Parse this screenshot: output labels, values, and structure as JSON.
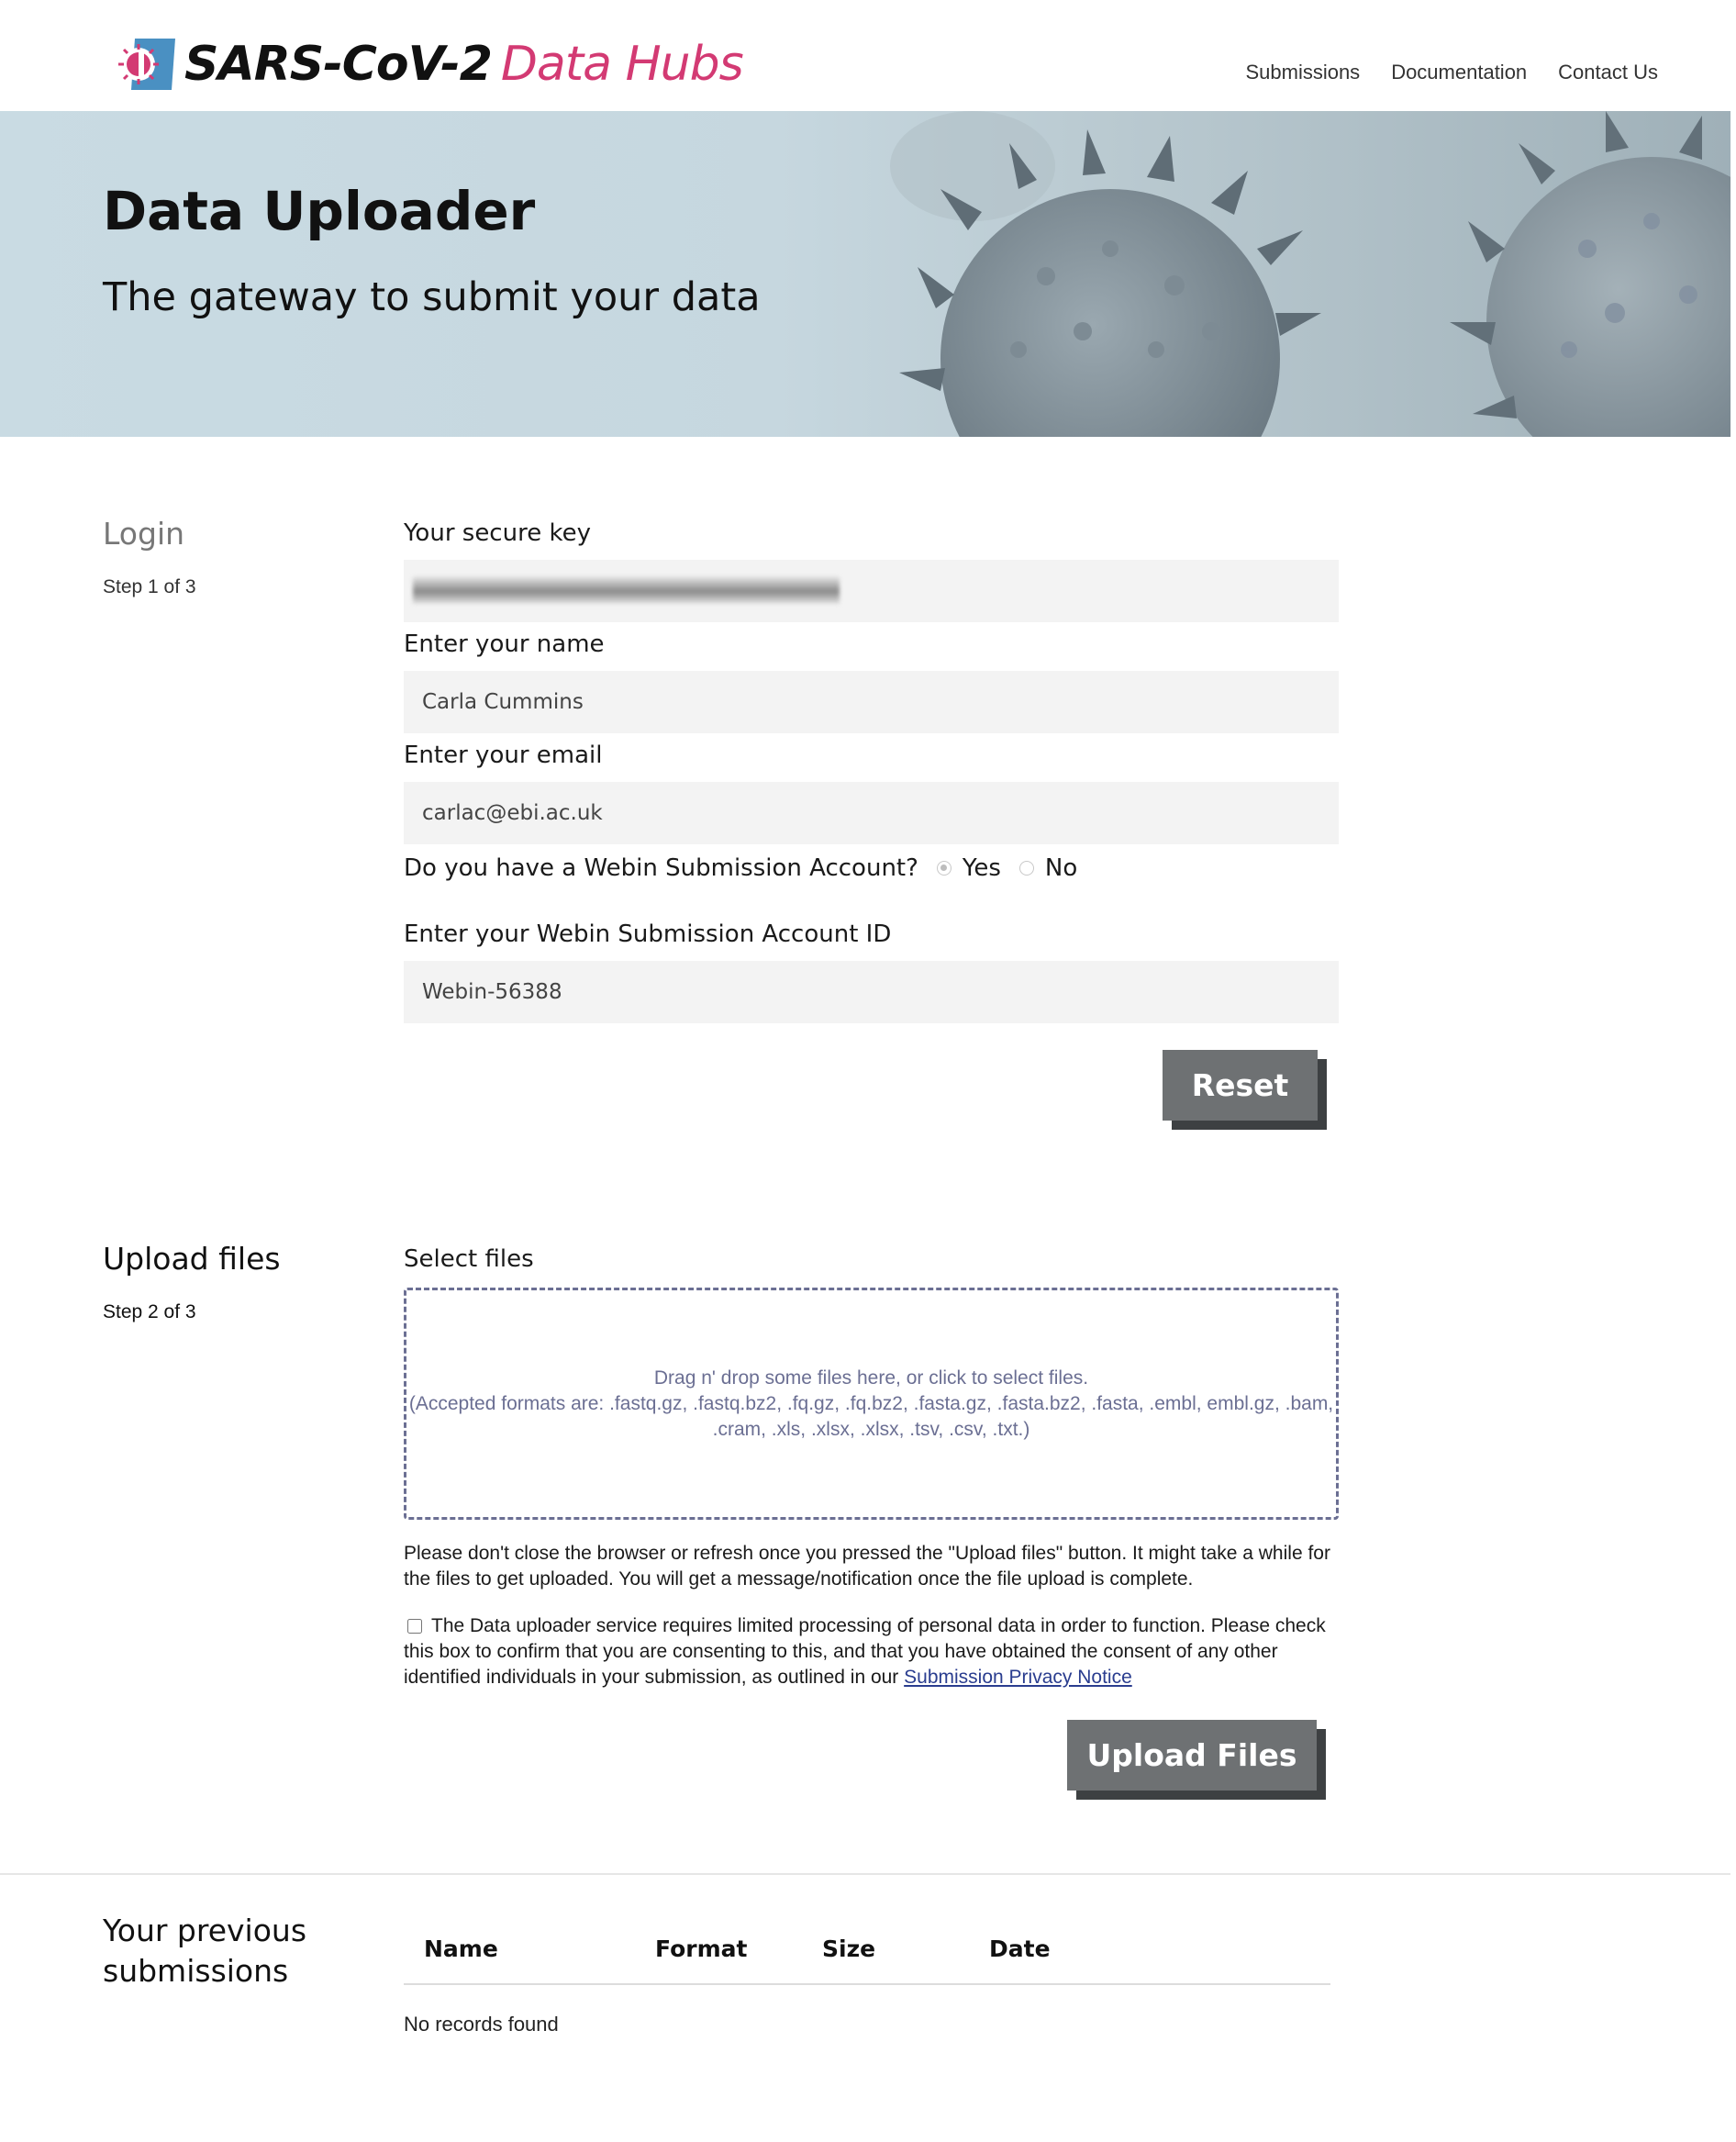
{
  "header": {
    "logo_strong": "SARS-CoV-2",
    "logo_accent": "Data Hubs",
    "nav": [
      "Submissions",
      "Documentation",
      "Contact Us"
    ]
  },
  "hero": {
    "title": "Data Uploader",
    "subtitle": "The gateway to submit your data"
  },
  "login": {
    "title": "Login",
    "step": "Step 1 of 3",
    "secure_key_label": "Your secure key",
    "name_label": "Enter your name",
    "name_value": "Carla Cummins",
    "email_label": "Enter your email",
    "email_value": "carlac@ebi.ac.uk",
    "webin_question": "Do you have a Webin Submission Account?",
    "yes_label": "Yes",
    "no_label": "No",
    "selected": "Yes",
    "webin_id_label": "Enter your Webin Submission Account ID",
    "webin_id_value": "Webin-56388",
    "reset_label": "Reset"
  },
  "upload": {
    "title": "Upload files",
    "step": "Step 2 of 3",
    "select_label": "Select files",
    "dropzone_line1": "Drag n' drop some files here, or click to select files.",
    "dropzone_line2": "(Accepted formats are: .fastq.gz, .fastq.bz2, .fq.gz, .fq.bz2, .fasta.gz, .fasta.bz2, .fasta, .embl, embl.gz, .bam, .cram, .xls, .xlsx, .xlsx, .tsv, .csv, .txt.)",
    "notice": "Please don't close the browser or refresh once you pressed the \"Upload files\" button. It might take a while for the files to get uploaded. You will get a message/notification once the file upload is complete.",
    "consent_text": "The Data uploader service requires limited processing of personal data in order to function. Please check this box to confirm that you are consenting to this, and that you have obtained the consent of any other identified individuals in your submission, as outlined in our",
    "privacy_link": "Submission Privacy Notice",
    "upload_label": "Upload Files"
  },
  "previous": {
    "title_line1": "Your previous",
    "title_line2": "submissions",
    "columns": [
      "Name",
      "Format",
      "Size",
      "Date"
    ],
    "empty": "No records found"
  }
}
